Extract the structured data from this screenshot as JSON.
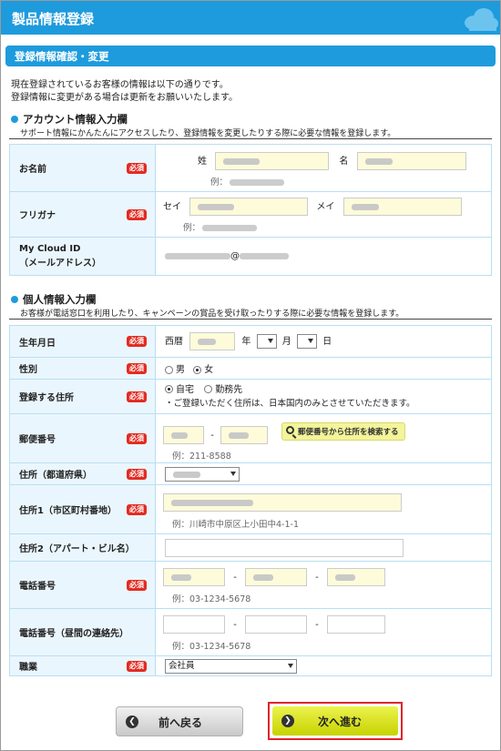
{
  "header": {
    "title": "製品情報登録"
  },
  "section": {
    "title": "登録情報確認・変更"
  },
  "intro": {
    "line1": "現在登録されているお客様の情報は以下の通りです。",
    "line2": "登録情報に変更がある場合は更新をお願いいたします。"
  },
  "account": {
    "heading": "アカウント情報入力欄",
    "desc": "サポート情報にかんたんにアクセスしたり、登録情報を変更したりする際に必要な情報を登録します。",
    "name_label": "お名前",
    "sei_label": "姓",
    "mei_label": "名",
    "name_example": "例：",
    "kana_label": "フリガナ",
    "sei_kana_label": "セイ",
    "mei_kana_label": "メイ",
    "kana_example": "例：",
    "cloud_id_label_line1": "My Cloud ID",
    "cloud_id_label_line2": "（メールアドレス）",
    "email_at": "@"
  },
  "personal": {
    "heading": "個人情報入力欄",
    "desc": "お客様が電話窓口を利用したり、キャンペーンの賞品を受け取ったりする際に必要な情報を登録します。",
    "birth_label": "生年月日",
    "era": "西暦",
    "year": "年",
    "month": "月",
    "day": "日",
    "gender_label": "性別",
    "male": "男",
    "female": "女",
    "address_type_label": "登録する住所",
    "home": "自宅",
    "work": "勤務先",
    "address_note": "・ご登録いただく住所は、日本国内のみとさせていただきます。",
    "postal_label": "郵便番号",
    "postal_dash": "-",
    "postal_search": "郵便番号から住所を検索する",
    "postal_example": "例：211-8588",
    "pref_label": "住所（都道府県）",
    "addr1_label": "住所1（市区町村番地）",
    "addr1_example": "例：川崎市中原区上小田中4-1-1",
    "addr2_label": "住所2（アパート・ビル名）",
    "phone_label": "電話番号",
    "phone_dash1": "-",
    "phone_dash2": "-",
    "phone_example": "例：03-1234-5678",
    "dayphone_label": "電話番号（昼間の連絡先）",
    "dayphone_dash1": "-",
    "dayphone_dash2": "-",
    "dayphone_example": "例：03-1234-5678",
    "job_label": "職業",
    "job_value": "会社員"
  },
  "required_badge": "必須",
  "buttons": {
    "back": "前へ戻る",
    "next": "次へ進む"
  },
  "colors": {
    "brand": "#1e9bdc",
    "required": "#e32b22",
    "input_bg": "#fdfbd9",
    "next_btn": "#d4dc1a",
    "highlight": "#e0242b"
  }
}
